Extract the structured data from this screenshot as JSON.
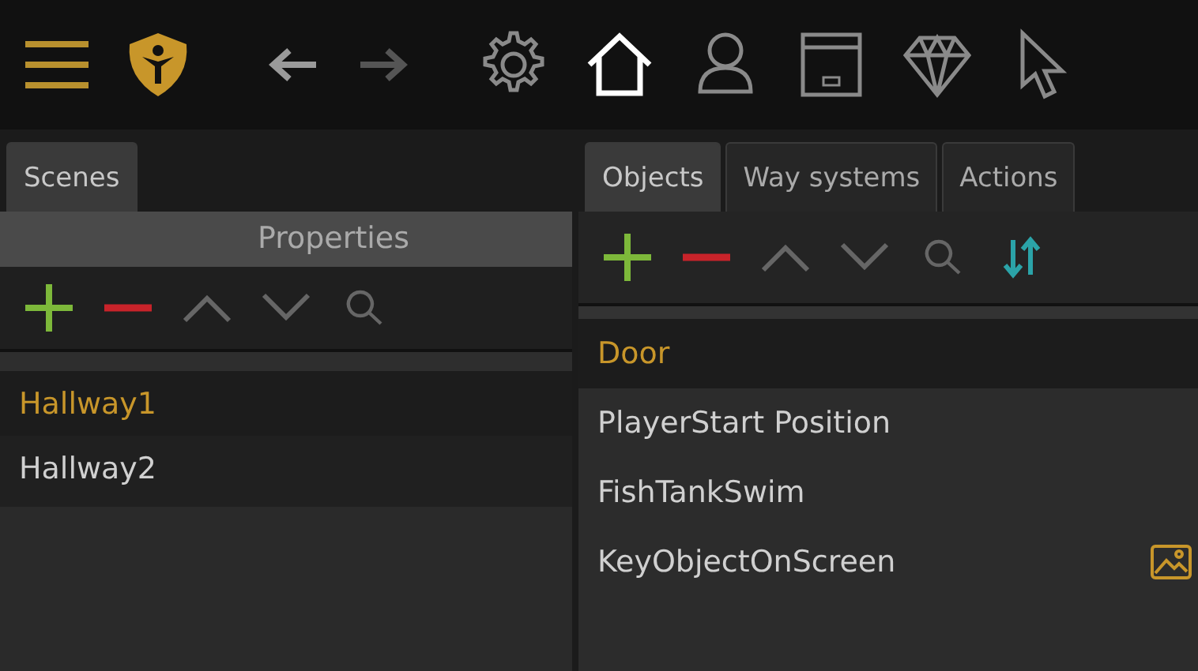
{
  "toolbar": {
    "menu": {
      "kind": "menu"
    },
    "logo": {
      "kind": "logo"
    },
    "nav": [
      {
        "kind": "back",
        "disabled": false
      },
      {
        "kind": "forward",
        "disabled": true
      }
    ],
    "tools": [
      {
        "kind": "settings",
        "selected": false
      },
      {
        "kind": "home",
        "selected": true
      },
      {
        "kind": "user",
        "selected": false
      },
      {
        "kind": "dialog",
        "selected": false
      },
      {
        "kind": "diamond",
        "selected": false
      },
      {
        "kind": "pointer",
        "selected": false
      }
    ]
  },
  "left_panel": {
    "tabs": [
      {
        "label": "Scenes",
        "selected": true
      }
    ],
    "header": "Properties",
    "actions": [
      {
        "kind": "add"
      },
      {
        "kind": "remove"
      },
      {
        "kind": "up"
      },
      {
        "kind": "down"
      },
      {
        "kind": "search"
      }
    ],
    "items": [
      {
        "label": "Hallway1",
        "selected": true
      },
      {
        "label": "Hallway2",
        "selected": false
      }
    ]
  },
  "right_panel": {
    "tabs": [
      {
        "label": "Objects",
        "selected": true
      },
      {
        "label": "Way systems",
        "selected": false
      },
      {
        "label": "Actions",
        "selected": false
      }
    ],
    "actions": [
      {
        "kind": "add"
      },
      {
        "kind": "remove"
      },
      {
        "kind": "up"
      },
      {
        "kind": "down"
      },
      {
        "kind": "search"
      },
      {
        "kind": "sort"
      }
    ],
    "items": [
      {
        "label": "Door",
        "selected": true,
        "has_image": false
      },
      {
        "label": "PlayerStart Position",
        "selected": false,
        "has_image": false
      },
      {
        "label": "FishTankSwim",
        "selected": false,
        "has_image": false
      },
      {
        "label": "KeyObjectOnScreen",
        "selected": false,
        "has_image": true
      }
    ]
  }
}
